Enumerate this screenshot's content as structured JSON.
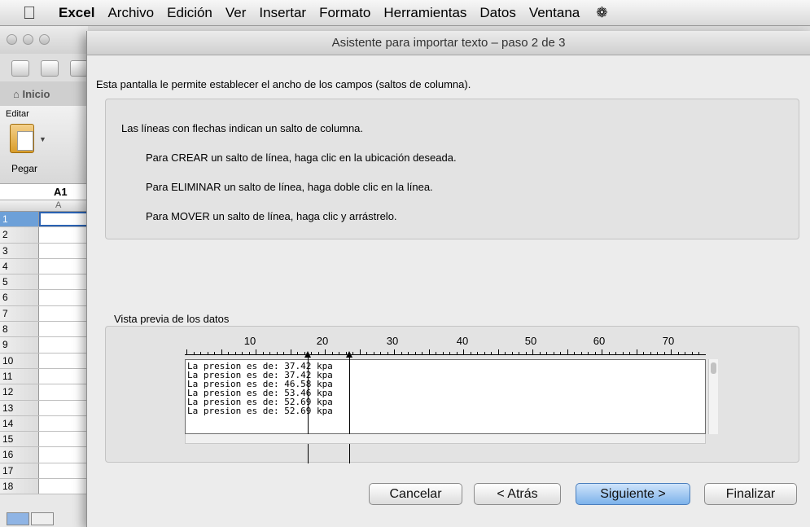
{
  "menubar": {
    "app": "Excel",
    "items": [
      "Archivo",
      "Edición",
      "Ver",
      "Insertar",
      "Formato",
      "Herramientas",
      "Datos",
      "Ventana"
    ]
  },
  "excel": {
    "tab_label": "Inicio",
    "group_label": "Editar",
    "paste_label": "Pegar",
    "name_box": "A1",
    "column_header": "A",
    "rows": [
      "1",
      "2",
      "3",
      "4",
      "5",
      "6",
      "7",
      "8",
      "9",
      "10",
      "11",
      "12",
      "13",
      "14",
      "15",
      "16",
      "17",
      "18"
    ]
  },
  "dialog": {
    "title": "Asistente para importar texto – paso 2 de 3",
    "intro": "Esta pantalla le permite establecer el ancho de los campos (saltos de columna).",
    "info_header": "Las líneas con flechas indican un salto de columna.",
    "instructions": [
      "Para CREAR un salto de línea, haga clic en la ubicación deseada.",
      "Para ELIMINAR un salto de línea, haga doble clic en la línea.",
      "Para MOVER un salto de línea, haga clic y arrástrelo."
    ],
    "preview_label": "Vista previa de los datos",
    "ruler_numbers": [
      "10",
      "20",
      "30",
      "40",
      "50",
      "60",
      "70"
    ],
    "preview_lines": [
      "La presion es de: 37.42 kpa",
      "La presion es de: 37.42 kpa",
      "La presion es de: 46.58 kpa",
      "La presion es de: 53.46 kpa",
      "La presion es de: 52.69 kpa",
      "La presion es de: 52.69 kpa"
    ],
    "column_breaks": [
      18,
      24
    ],
    "buttons": {
      "cancel": "Cancelar",
      "back": "< Atrás",
      "next": "Siguiente >",
      "finish": "Finalizar"
    }
  }
}
